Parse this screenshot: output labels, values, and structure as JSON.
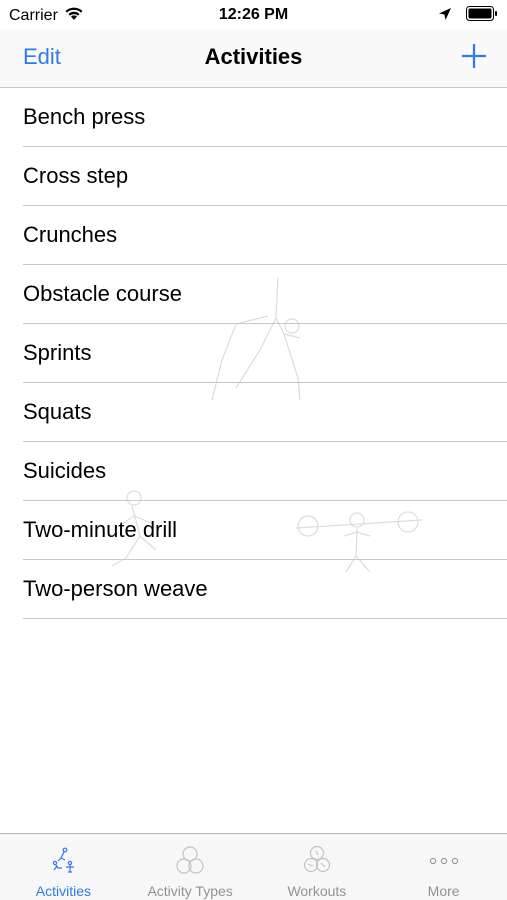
{
  "status_bar": {
    "carrier": "Carrier",
    "time": "12:26 PM"
  },
  "nav": {
    "edit_label": "Edit",
    "title": "Activities",
    "add_icon": "plus-icon"
  },
  "activities": [
    "Bench press",
    "Cross step",
    "Crunches",
    "Obstacle course",
    "Sprints",
    "Squats",
    "Suicides",
    "Two-minute drill",
    "Two-person weave"
  ],
  "tabs": [
    {
      "label": "Activities",
      "icon": "activities-icon",
      "active": true
    },
    {
      "label": "Activity Types",
      "icon": "activity-types-icon",
      "active": false
    },
    {
      "label": "Workouts",
      "icon": "workouts-icon",
      "active": false
    },
    {
      "label": "More",
      "icon": "more-icon",
      "active": false
    }
  ],
  "colors": {
    "accent": "#2f7ae5",
    "inactive_tab": "#929292",
    "separator": "#c8c7cc"
  }
}
